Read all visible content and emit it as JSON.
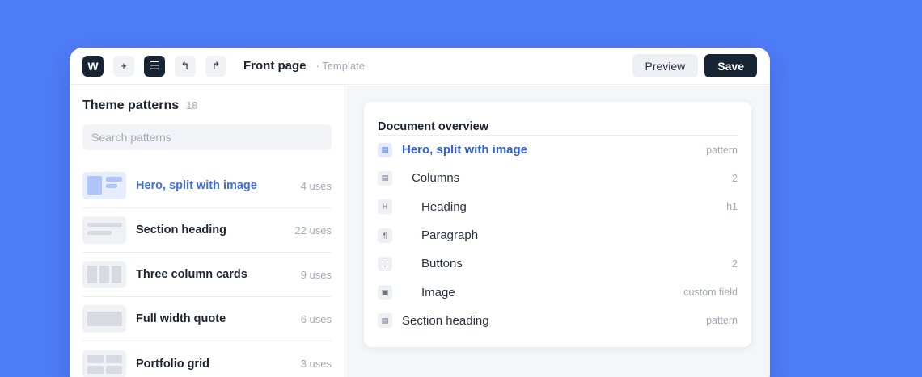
{
  "toolbar": {
    "logo_letter": "W",
    "add_glyph": "+",
    "list_view_glyph": "☰",
    "undo_glyph": "↰",
    "redo_glyph": "↱",
    "title": "Front page",
    "subtitle": "· Template",
    "preview_label": "Preview",
    "save_label": "Save"
  },
  "patterns": {
    "title": "Theme patterns",
    "count": "18",
    "search_placeholder": "Search patterns",
    "items": [
      {
        "name": "Hero, split with image",
        "uses": "4 uses",
        "active": true,
        "thumb": "hero"
      },
      {
        "name": "Section heading",
        "uses": "22 uses",
        "active": false,
        "thumb": "heading"
      },
      {
        "name": "Three column cards",
        "uses": "9 uses",
        "active": false,
        "thumb": "columns"
      },
      {
        "name": "Full width quote",
        "uses": "6 uses",
        "active": false,
        "thumb": "quote"
      },
      {
        "name": "Portfolio grid",
        "uses": "3 uses",
        "active": false,
        "thumb": "grid"
      }
    ]
  },
  "overview": {
    "title": "Document overview",
    "rows": [
      {
        "icon": "▤",
        "icon_name": "pattern-icon",
        "label": "Hero, split with image",
        "meta": "pattern",
        "depth": 0,
        "active": true
      },
      {
        "icon": "▤",
        "icon_name": "columns-icon",
        "label": "Columns",
        "meta": "2",
        "depth": 1,
        "active": false
      },
      {
        "icon": "H",
        "icon_name": "heading-icon",
        "label": "Heading",
        "meta": "h1",
        "depth": 2,
        "active": false
      },
      {
        "icon": "¶",
        "icon_name": "paragraph-icon",
        "label": "Paragraph",
        "meta": "",
        "depth": 2,
        "active": false
      },
      {
        "icon": "□",
        "icon_name": "buttons-icon",
        "label": "Buttons",
        "meta": "2",
        "depth": 2,
        "active": false
      },
      {
        "icon": "▣",
        "icon_name": "image-icon",
        "label": "Image",
        "meta": "custom field",
        "depth": 2,
        "active": false
      },
      {
        "icon": "▤",
        "icon_name": "pattern-icon",
        "label": "Section heading",
        "meta": "pattern",
        "depth": 0,
        "active": false
      }
    ]
  },
  "colors": {
    "background": "#4f7cf7",
    "accent": "#3f6fe0",
    "dark": "#172433"
  }
}
